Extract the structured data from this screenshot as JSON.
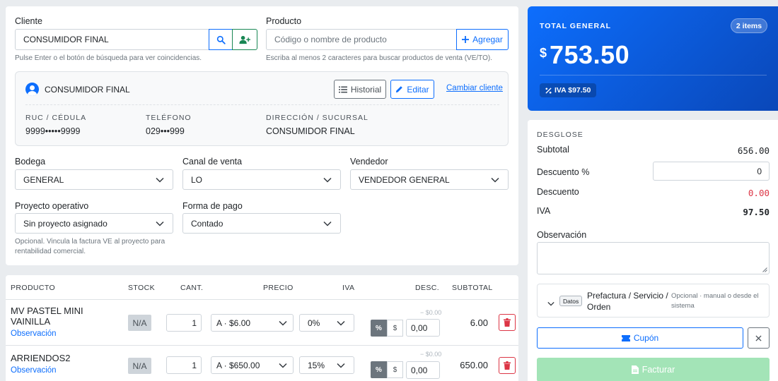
{
  "cliente": {
    "label": "Cliente",
    "value": "CONSUMIDOR FINAL",
    "hint": "Pulse Enter o el botón de búsqueda para ver coincidencias."
  },
  "producto": {
    "label": "Producto",
    "placeholder": "Código o nombre de producto",
    "add_label": "Agregar",
    "hint": "Escriba al menos 2 caracteres para buscar productos de venta (VE/TO)."
  },
  "client_card": {
    "name": "CONSUMIDOR FINAL",
    "historial_label": "Historial",
    "editar_label": "Editar",
    "cambiar_label": "Cambiar cliente",
    "ruc_label": "RUC / CÉDULA",
    "ruc_value": "9999•••••9999",
    "tel_label": "TELÉFONO",
    "tel_value": "029•••999",
    "dir_label": "DIRECCIÓN / SUCURSAL",
    "dir_value": "CONSUMIDOR FINAL"
  },
  "fields": {
    "bodega_label": "Bodega",
    "bodega_value": "GENERAL",
    "canal_label": "Canal de venta",
    "canal_value": "LO",
    "vendedor_label": "Vendedor",
    "vendedor_value": "VENDEDOR GENERAL",
    "proyecto_label": "Proyecto operativo",
    "proyecto_value": "Sin proyecto asignado",
    "proyecto_hint_1": "Opcional. Vincula la factura VE al proyecto para",
    "proyecto_hint_2": "rentabilidad comercial.",
    "pago_label": "Forma de pago",
    "pago_value": "Contado"
  },
  "table": {
    "headers": {
      "producto": "PRODUCTO",
      "stock": "STOCK",
      "cant": "CANT.",
      "precio": "PRECIO",
      "iva": "IVA",
      "desc": "DESC.",
      "subtotal": "SUBTOTAL"
    },
    "rows": [
      {
        "name_1": "MV PASTEL MINI",
        "name_2": "VAINILLA",
        "obs": "Observación",
        "stock": "N/A",
        "qty": "1",
        "price": "A · $6.00",
        "iva": "0%",
        "disc_hint": "− $0.00",
        "pct": "%",
        "usd": "$",
        "disc": "0,00",
        "subtotal": "6.00"
      },
      {
        "name_1": "ARRIENDOS2",
        "name_2": "",
        "obs": "Observación",
        "stock": "N/A",
        "qty": "1",
        "price": "A · $650.00",
        "iva": "15%",
        "disc_hint": "− $0.00",
        "pct": "%",
        "usd": "$",
        "disc": "0,00",
        "subtotal": "650.00"
      }
    ]
  },
  "total": {
    "label": "TOTAL GENERAL",
    "items_badge": "2 items",
    "currency": "$",
    "amount": "753.50",
    "iva_badge": "IVA $97.50"
  },
  "desglose": {
    "title": "DESGLOSE",
    "subtotal_label": "Subtotal",
    "subtotal_value": "656.00",
    "descuento_pct_label": "Descuento %",
    "descuento_pct_value": "0",
    "descuento_label": "Descuento",
    "descuento_value": "0.00",
    "iva_label": "IVA",
    "iva_value": "97.50",
    "observacion_label": "Observación",
    "datos_badge": "Datos",
    "prefactura_1": "Prefactura / Servicio /",
    "prefactura_2": "Orden",
    "prefactura_hint_1": "Opcional · manual o desde el",
    "prefactura_hint_2": "sistema",
    "cupon_label": "Cupón",
    "facturar_label": "Facturar"
  },
  "colors": {
    "primary": "#0d6efd",
    "success": "#198754",
    "danger": "#dc3545",
    "total_gradient_start": "#0d6efd",
    "total_gradient_end": "#0a47b8",
    "facturar_disabled": "#a3e4b7"
  }
}
